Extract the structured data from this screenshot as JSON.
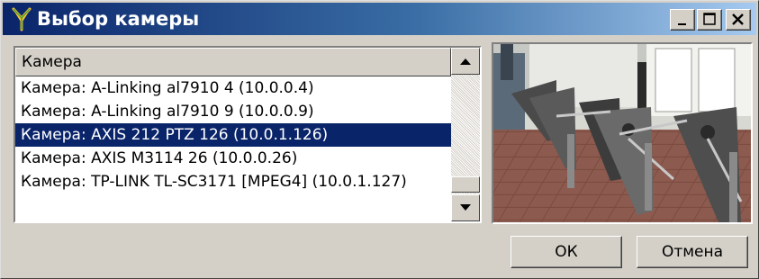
{
  "window": {
    "title": "Выбор камеры",
    "controls": {
      "minimize": "_",
      "maximize": "□",
      "close": "×"
    }
  },
  "camera_list": {
    "header": "Камера",
    "items": [
      {
        "label": "Камера: A-Linking al7910 4 (10.0.0.4)",
        "selected": false
      },
      {
        "label": "Камера: A-Linking al7910 9 (10.0.0.9)",
        "selected": false
      },
      {
        "label": "Камера: AXIS 212 PTZ 126 (10.0.1.126)",
        "selected": true
      },
      {
        "label": "Камера: AXIS M3114 26 (10.0.0.26)",
        "selected": false
      },
      {
        "label": "Камера: TP-LINK TL-SC3171 [MPEG4] (10.0.1.127)",
        "selected": false
      }
    ]
  },
  "preview": {
    "icon": "camera-preview-image"
  },
  "buttons": {
    "ok": "ОК",
    "cancel": "Отмена"
  },
  "colors": {
    "selection": "#0a246a",
    "title_start": "#0a246a",
    "title_end": "#a6caf0",
    "face": "#d4d0c8"
  }
}
